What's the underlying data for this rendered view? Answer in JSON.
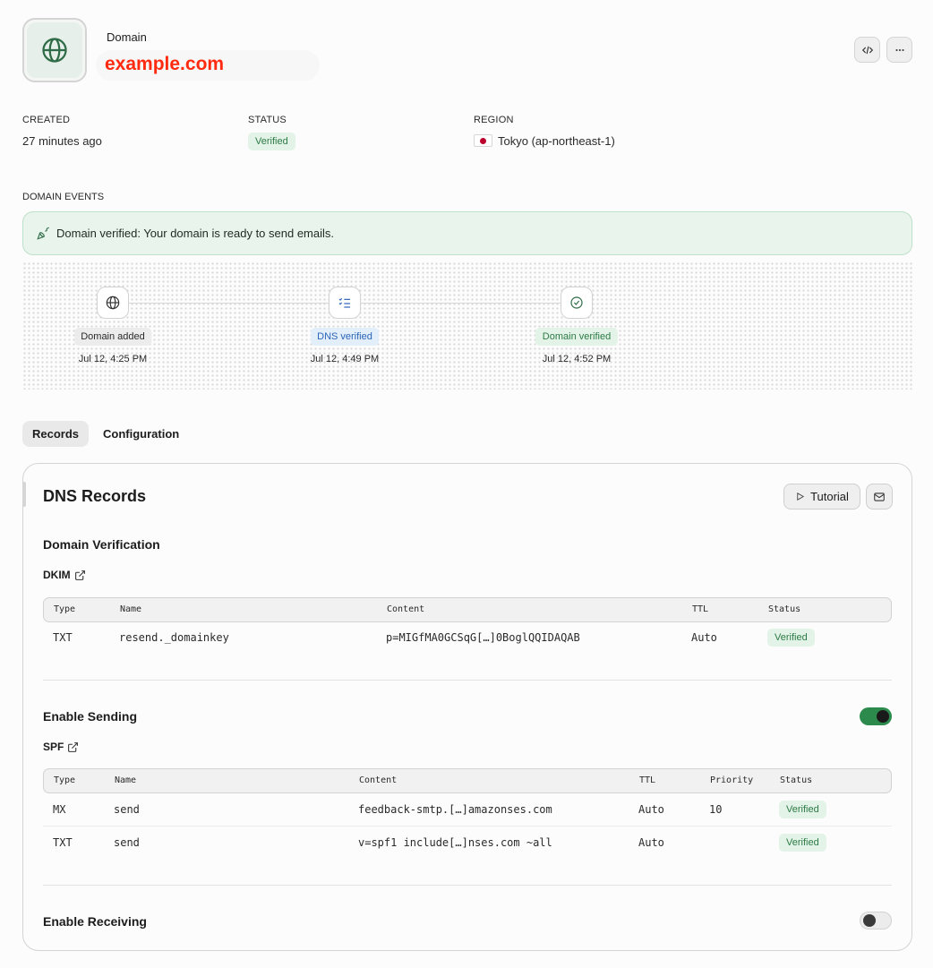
{
  "header": {
    "label": "Domain",
    "domain": "example.com",
    "code_icon": "code-icon",
    "more_icon": "more-horizontal-icon"
  },
  "meta": {
    "created_label": "CREATED",
    "created_value": "27 minutes ago",
    "status_label": "STATUS",
    "status_value": "Verified",
    "region_label": "REGION",
    "region_value": "Tokyo (ap-northeast-1)"
  },
  "events": {
    "label": "DOMAIN EVENTS",
    "banner_strong": "Domain verified:",
    "banner_text": " Your domain is ready to send emails.",
    "steps": [
      {
        "label": "Domain added",
        "date": "Jul 12, 4:25 PM",
        "icon": "globe-icon"
      },
      {
        "label": "DNS verified",
        "date": "Jul 12, 4:49 PM",
        "icon": "list-checks-icon"
      },
      {
        "label": "Domain verified",
        "date": "Jul 12, 4:52 PM",
        "icon": "check-circle-icon"
      }
    ]
  },
  "tabs": [
    {
      "label": "Records",
      "active": true
    },
    {
      "label": "Configuration",
      "active": false
    }
  ],
  "card": {
    "title": "DNS Records",
    "tutorial_label": "Tutorial",
    "verification": {
      "title": "Domain Verification",
      "sub_title": "DKIM",
      "headers": [
        "Type",
        "Name",
        "Content",
        "TTL",
        "Status"
      ],
      "rows": [
        {
          "type": "TXT",
          "name": "resend._domainkey",
          "content": "p=MIGfMA0GCSqG[…]0BoglQQIDAQAB",
          "ttl": "Auto",
          "status": "Verified"
        }
      ]
    },
    "sending": {
      "title": "Enable Sending",
      "enabled": true,
      "sub_title": "SPF",
      "headers": [
        "Type",
        "Name",
        "Content",
        "TTL",
        "Priority",
        "Status"
      ],
      "rows": [
        {
          "type": "MX",
          "name": "send",
          "content": "feedback-smtp.[…]amazonses.com",
          "ttl": "Auto",
          "priority": "10",
          "status": "Verified"
        },
        {
          "type": "TXT",
          "name": "send",
          "content": "v=spf1 include[…]nses.com ~all",
          "ttl": "Auto",
          "priority": "",
          "status": "Verified"
        }
      ]
    },
    "receiving": {
      "title": "Enable Receiving",
      "enabled": false
    }
  },
  "colors": {
    "brand_red": "#ff2a0f",
    "verified_green": "#2b7a45",
    "toggle_on": "#2d8a4d",
    "dns_blue": "#2a64b8"
  }
}
